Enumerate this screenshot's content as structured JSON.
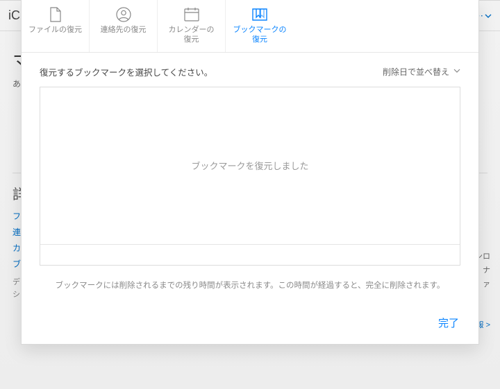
{
  "background": {
    "brand_fragment": "iC",
    "dropdown_fragment": "⋯",
    "heading_fragment": "マ",
    "sub_fragment": "あ",
    "section_heading_fragment": "詳",
    "links": [
      "フ",
      "連",
      "カ",
      "ブ"
    ],
    "footer_lines": [
      "デ",
      "シ"
    ],
    "right_lines": [
      "ンロ",
      "ナ",
      "ァ"
    ],
    "right_link": "報 >"
  },
  "tabs": [
    {
      "id": "files",
      "label": "ファイルの復元"
    },
    {
      "id": "contacts",
      "label": "連絡先の復元"
    },
    {
      "id": "calendar",
      "label": "カレンダーの\n復元"
    },
    {
      "id": "bookmarks",
      "label": "ブックマークの\n復元",
      "active": true
    }
  ],
  "body": {
    "instruction": "復元するブックマークを選択してください。",
    "sort_label": "削除日で並べ替え",
    "empty_message": "ブックマークを復元しました",
    "hint": "ブックマークには削除されるまでの残り時間が表示されます。この時間が経過すると、完全に削除されます。"
  },
  "footer": {
    "done_label": "完了"
  }
}
